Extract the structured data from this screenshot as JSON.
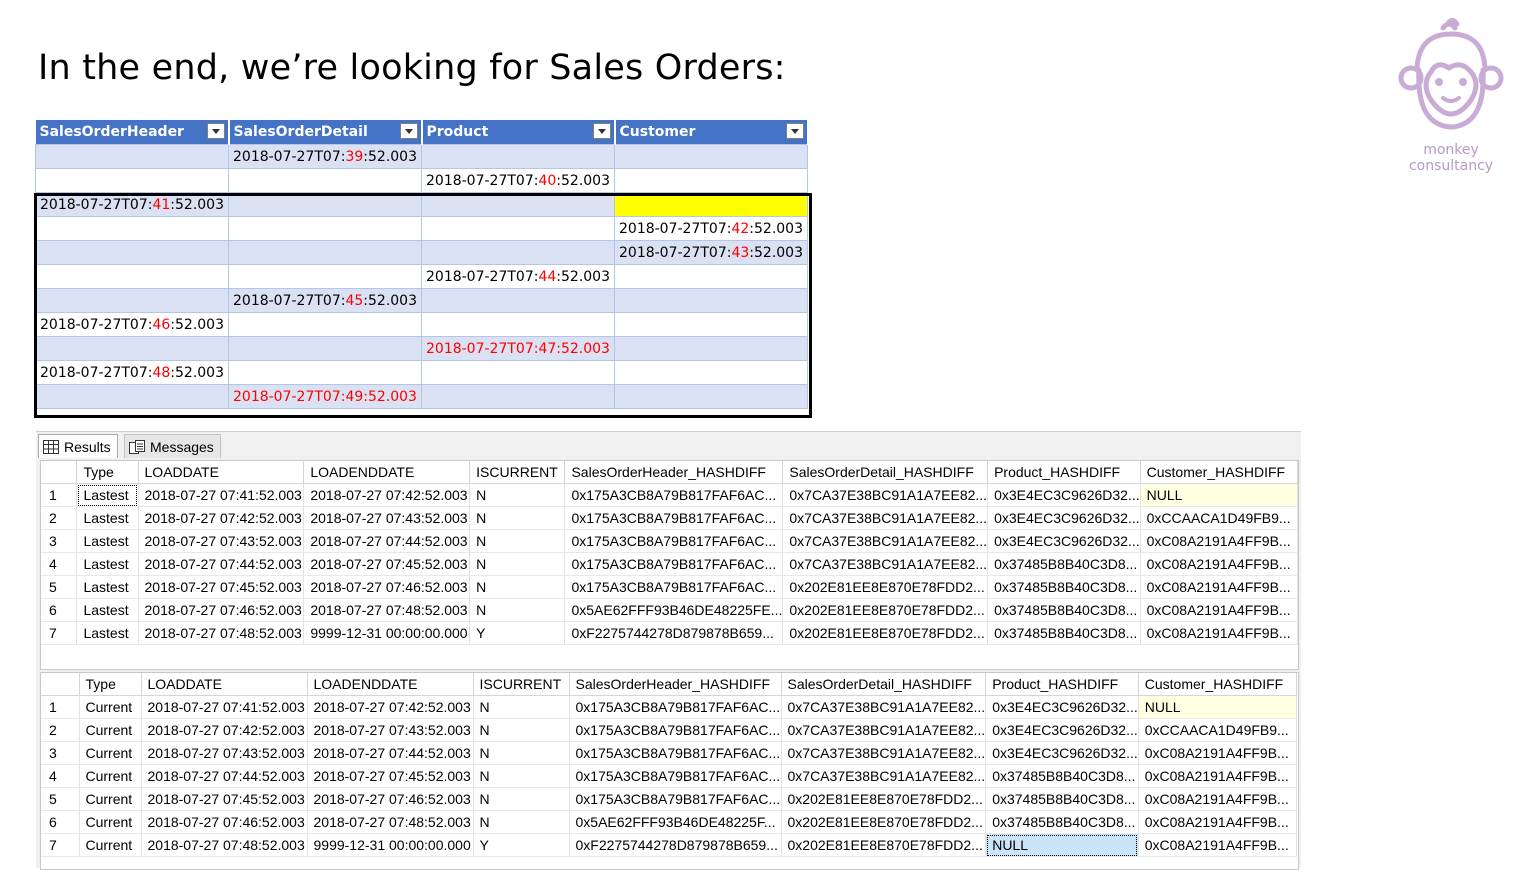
{
  "slide": {
    "title": "In the end, we’re looking for Sales Orders:"
  },
  "logo": {
    "line1": "monkey",
    "line2": "consultancy",
    "color": "#b79ac6",
    "icon": "monkey-face-icon"
  },
  "timeline": {
    "headers": [
      "SalesOrderHeader",
      "SalesOrderDetail",
      "Product",
      "Customer"
    ],
    "header_color": "#4472c4",
    "band_color": "#d9e1f2",
    "highlight_color": "#ff0000",
    "rows": [
      {
        "col": 1,
        "pre": "2018-07-27T07:",
        "mid": "39",
        "post": ":52.003",
        "all_red": false
      },
      {
        "col": 2,
        "pre": "2018-07-27T07:",
        "mid": "40",
        "post": ":52.003",
        "all_red": false
      },
      {
        "col": 0,
        "pre": "2018-07-27T07:",
        "mid": "41",
        "post": ":52.003",
        "all_red": false
      },
      {
        "col": 3,
        "pre": "2018-07-27T07:",
        "mid": "42",
        "post": ":52.003",
        "all_red": false
      },
      {
        "col": 3,
        "pre": "2018-07-27T07:",
        "mid": "43",
        "post": ":52.003",
        "all_red": false
      },
      {
        "col": 2,
        "pre": "2018-07-27T07:",
        "mid": "44",
        "post": ":52.003",
        "all_red": false
      },
      {
        "col": 1,
        "pre": "2018-07-27T07:",
        "mid": "45",
        "post": ":52.003",
        "all_red": false
      },
      {
        "col": 0,
        "pre": "2018-07-27T07:",
        "mid": "46",
        "post": ":52.003",
        "all_red": false
      },
      {
        "col": 2,
        "pre": "",
        "mid": "",
        "post": "2018-07-27T07:47:52.003",
        "all_red": true
      },
      {
        "col": 0,
        "pre": "2018-07-27T07:",
        "mid": "48",
        "post": ":52.003",
        "all_red": false
      },
      {
        "col": 1,
        "pre": "",
        "mid": "",
        "post": "2018-07-27T07:49:52.003",
        "all_red": true
      }
    ],
    "yellow_cell": {
      "row": 2,
      "col": 3
    }
  },
  "ssms": {
    "tabs": {
      "results": "Results",
      "messages": "Messages"
    },
    "columns": [
      "",
      "Type",
      "LOADDATE",
      "LOADENDDATE",
      "ISCURRENT",
      "SalesOrderHeader_HASHDIFF",
      "SalesOrderDetail_HASHDIFF",
      "Product_HASHDIFF",
      "Customer_HASHDIFF"
    ],
    "grid1": [
      [
        "1",
        "Lastest",
        "2018-07-27 07:41:52.003",
        "2018-07-27 07:42:52.003",
        "N",
        "0x175A3CB8A79B817FAF6AC...",
        "0x7CA37E38BC91A1A7EE82...",
        "0x3E4EC3C9626D32...",
        "NULL"
      ],
      [
        "2",
        "Lastest",
        "2018-07-27 07:42:52.003",
        "2018-07-27 07:43:52.003",
        "N",
        "0x175A3CB8A79B817FAF6AC...",
        "0x7CA37E38BC91A1A7EE82...",
        "0x3E4EC3C9626D32...",
        "0xCCAACA1D49FB9..."
      ],
      [
        "3",
        "Lastest",
        "2018-07-27 07:43:52.003",
        "2018-07-27 07:44:52.003",
        "N",
        "0x175A3CB8A79B817FAF6AC...",
        "0x7CA37E38BC91A1A7EE82...",
        "0x3E4EC3C9626D32...",
        "0xC08A2191A4FF9B..."
      ],
      [
        "4",
        "Lastest",
        "2018-07-27 07:44:52.003",
        "2018-07-27 07:45:52.003",
        "N",
        "0x175A3CB8A79B817FAF6AC...",
        "0x7CA37E38BC91A1A7EE82...",
        "0x37485B8B40C3D8...",
        "0xC08A2191A4FF9B..."
      ],
      [
        "5",
        "Lastest",
        "2018-07-27 07:45:52.003",
        "2018-07-27 07:46:52.003",
        "N",
        "0x175A3CB8A79B817FAF6AC...",
        "0x202E81EE8E870E78FDD2...",
        "0x37485B8B40C3D8...",
        "0xC08A2191A4FF9B..."
      ],
      [
        "6",
        "Lastest",
        "2018-07-27 07:46:52.003",
        "2018-07-27 07:48:52.003",
        "N",
        "0x5AE62FFF93B46DE48225FE...",
        "0x202E81EE8E870E78FDD2...",
        "0x37485B8B40C3D8...",
        "0xC08A2191A4FF9B..."
      ],
      [
        "7",
        "Lastest",
        "2018-07-27 07:48:52.003",
        "9999-12-31 00:00:00.000",
        "Y",
        "0xF2275744278D879878B659...",
        "0x202E81EE8E870E78FDD2...",
        "0x37485B8B40C3D8...",
        "0xC08A2191A4FF9B..."
      ]
    ],
    "grid2": [
      [
        "1",
        "Current",
        "2018-07-27 07:41:52.003",
        "2018-07-27 07:42:52.003",
        "N",
        "0x175A3CB8A79B817FAF6AC...",
        "0x7CA37E38BC91A1A7EE82...",
        "0x3E4EC3C9626D32...",
        "NULL"
      ],
      [
        "2",
        "Current",
        "2018-07-27 07:42:52.003",
        "2018-07-27 07:43:52.003",
        "N",
        "0x175A3CB8A79B817FAF6AC...",
        "0x7CA37E38BC91A1A7EE82...",
        "0x3E4EC3C9626D32...",
        "0xCCAACA1D49FB9..."
      ],
      [
        "3",
        "Current",
        "2018-07-27 07:43:52.003",
        "2018-07-27 07:44:52.003",
        "N",
        "0x175A3CB8A79B817FAF6AC...",
        "0x7CA37E38BC91A1A7EE82...",
        "0x3E4EC3C9626D32...",
        "0xC08A2191A4FF9B..."
      ],
      [
        "4",
        "Current",
        "2018-07-27 07:44:52.003",
        "2018-07-27 07:45:52.003",
        "N",
        "0x175A3CB8A79B817FAF6AC...",
        "0x7CA37E38BC91A1A7EE82...",
        "0x37485B8B40C3D8...",
        "0xC08A2191A4FF9B..."
      ],
      [
        "5",
        "Current",
        "2018-07-27 07:45:52.003",
        "2018-07-27 07:46:52.003",
        "N",
        "0x175A3CB8A79B817FAF6AC...",
        "0x202E81EE8E870E78FDD2...",
        "0x37485B8B40C3D8...",
        "0xC08A2191A4FF9B..."
      ],
      [
        "6",
        "Current",
        "2018-07-27 07:46:52.003",
        "2018-07-27 07:48:52.003",
        "N",
        "0x5AE62FFF93B46DE48225F...",
        "0x202E81EE8E870E78FDD2...",
        "0x37485B8B40C3D8...",
        "0xC08A2191A4FF9B..."
      ],
      [
        "7",
        "Current",
        "2018-07-27 07:48:52.003",
        "9999-12-31 00:00:00.000",
        "Y",
        "0xF2275744278D879878B659...",
        "0x202E81EE8E870E78FDD2...",
        "NULL",
        "0xC08A2191A4FF9B..."
      ]
    ],
    "null_color": "#ffffe1",
    "selected_color": "#cce4f7"
  }
}
